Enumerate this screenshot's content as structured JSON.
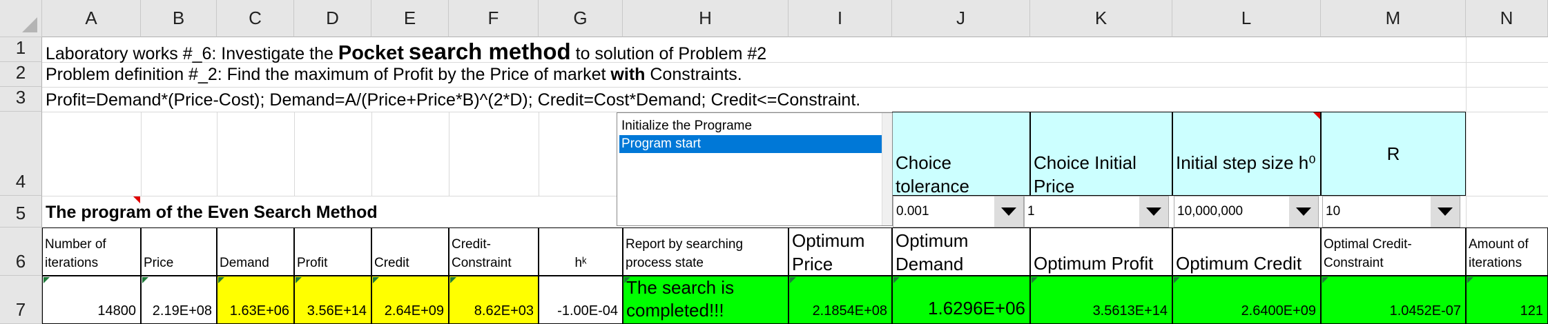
{
  "columns": [
    "A",
    "B",
    "C",
    "D",
    "E",
    "F",
    "G",
    "H",
    "I",
    "J",
    "K",
    "L",
    "M",
    "N"
  ],
  "rows": [
    "1",
    "2",
    "3",
    "4",
    "5",
    "6",
    "7"
  ],
  "row1": {
    "prefix": "Laboratory works #_6: Investigate the ",
    "bold1": "Pocket",
    "bold2": "search method",
    "suffix": " to solution of Problem #2"
  },
  "row2": {
    "prefix": "Problem definition  #_2: Find the maximum of Profit by the Price of market ",
    "bold": "with",
    "suffix": " Constraints."
  },
  "row3": {
    "text": "Profit=Demand*(Price-Cost);  Demand=A/(Price+Price*B)^(2*D); Credit=Cost*Demand; Credit<=Constraint."
  },
  "listbox": {
    "items": [
      "Initialize the Programe",
      "Program start"
    ],
    "selected_index": 1
  },
  "choice_headers": {
    "tolerance": "Choice tolerance",
    "initial_price": "Choice Initial Price",
    "step_size": "Initial step size h⁰",
    "r": "R"
  },
  "dropdowns": {
    "tolerance": "0.001",
    "initial_price": "1",
    "step_size": "10,000,000",
    "r": "10"
  },
  "row5_title": "The program of the Even Search Method",
  "headers": {
    "iterations": "Number of iterations",
    "price": "Price",
    "demand": "Demand",
    "profit": "Profit",
    "credit": "Credit",
    "credit_constraint": "Credit-Constraint",
    "hk": "hᵏ",
    "report": "Report by searching process state",
    "opt_price": "Optimum Price",
    "opt_demand": "Optimum Demand",
    "opt_profit": "Optimum Profit",
    "opt_credit": "Optimum Credit",
    "opt_credit_constraint": "Optimal Credit-Constraint",
    "amount_iterations": "Amount of iterations"
  },
  "values": {
    "iterations": "14800",
    "price": "2.19E+08",
    "demand": "1.63E+06",
    "profit": "3.56E+14",
    "credit": "2.64E+09",
    "credit_constraint": "8.62E+03",
    "hk": "-1.00E-04",
    "report": "The search is completed!!!",
    "opt_price": "2.1854E+08",
    "opt_demand": "1.6296E+06",
    "opt_profit": "3.5613E+14",
    "opt_credit": "2.6400E+09",
    "opt_credit_constraint": "1.0452E-07",
    "amount_iterations": "121"
  },
  "colors": {
    "yellow": "#ffff00",
    "green": "#00ff00",
    "cyan": "#ccffff",
    "selection": "#0078d7"
  }
}
